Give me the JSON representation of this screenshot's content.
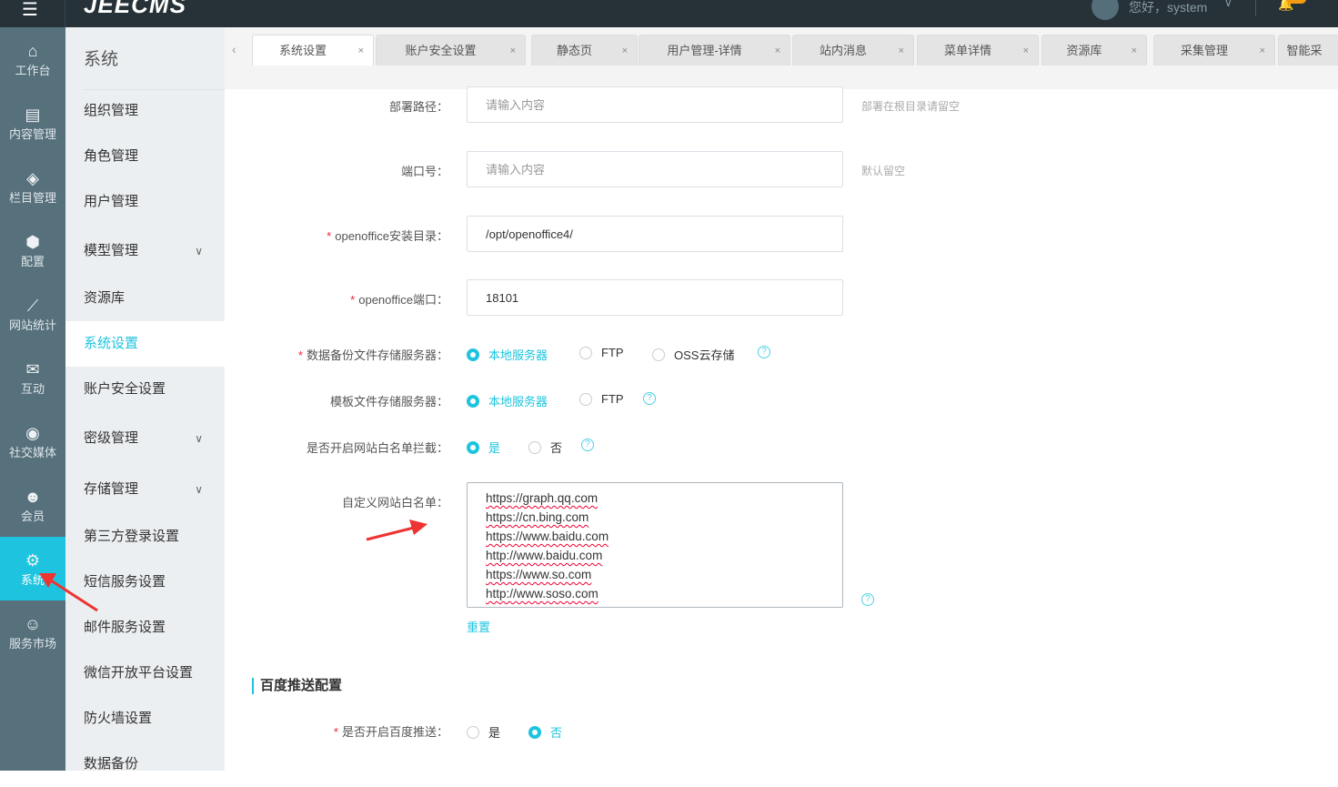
{
  "header": {
    "logo": "JEECMS",
    "greeting": "您好，system"
  },
  "iconbar": [
    {
      "label": "工作台",
      "icon": "home-icon",
      "glyph": "⌂"
    },
    {
      "label": "内容管理",
      "icon": "document-icon",
      "glyph": "▤"
    },
    {
      "label": "栏目管理",
      "icon": "layers-icon",
      "glyph": "◈"
    },
    {
      "label": "配置",
      "icon": "cube-icon",
      "glyph": "⬢"
    },
    {
      "label": "网站统计",
      "icon": "chart-icon",
      "glyph": "⟋"
    },
    {
      "label": "互动",
      "icon": "chat-icon",
      "glyph": "✉"
    },
    {
      "label": "社交媒体",
      "icon": "target-icon",
      "glyph": "◉"
    },
    {
      "label": "会员",
      "icon": "member-icon",
      "glyph": "☻"
    },
    {
      "label": "系统",
      "icon": "gear-icon",
      "glyph": "⚙"
    },
    {
      "label": "服务市场",
      "icon": "service-icon",
      "glyph": "☺"
    }
  ],
  "submenu": {
    "title": "系统",
    "items": [
      {
        "label": "组织管理"
      },
      {
        "label": "角色管理"
      },
      {
        "label": "用户管理"
      },
      {
        "label": "模型管理",
        "chev": "∨"
      },
      {
        "label": "资源库"
      },
      {
        "label": "系统设置"
      },
      {
        "label": "账户安全设置"
      },
      {
        "label": "密级管理",
        "chev": "∨"
      },
      {
        "label": "存储管理",
        "chev": "∨"
      },
      {
        "label": "第三方登录设置"
      },
      {
        "label": "短信服务设置"
      },
      {
        "label": "邮件服务设置"
      },
      {
        "label": "微信开放平台设置"
      },
      {
        "label": "防火墙设置"
      },
      {
        "label": "数据备份"
      }
    ]
  },
  "tabs": [
    "系统设置",
    "账户安全设置",
    "静态页",
    "用户管理-详情",
    "站内消息",
    "菜单详情",
    "资源库",
    "采集管理",
    "智能采"
  ],
  "form": {
    "deploy_path": {
      "label": "部署路径：",
      "placeholder": "请输入内容",
      "hint": "部署在根目录请留空"
    },
    "port": {
      "label": "端口号：",
      "placeholder": "请输入内容",
      "hint": "默认留空"
    },
    "oo_dir": {
      "label": "openoffice安装目录：",
      "value": "/opt/openoffice4/"
    },
    "oo_port": {
      "label": "openoffice端口：",
      "value": "18101"
    },
    "backup": {
      "label": "数据备份文件存储服务器：",
      "options": [
        "本地服务器",
        "FTP",
        "OSS云存储"
      ]
    },
    "template": {
      "label": "模板文件存储服务器：",
      "options": [
        "本地服务器",
        "FTP"
      ]
    },
    "whitelist_on": {
      "label": "是否开启网站白名单拦截：",
      "options": [
        "是",
        "否"
      ]
    },
    "whitelist": {
      "label": "自定义网站白名单：",
      "lines": [
        "https://graph.qq.com",
        "https://cn.bing.com",
        "https://www.baidu.com",
        "http://www.baidu.com",
        "https://www.so.com",
        "http://www.soso.com"
      ],
      "reset": "重置"
    },
    "section": "百度推送配置",
    "baidu": {
      "label": "是否开启百度推送：",
      "options": [
        "是",
        "否"
      ]
    },
    "required_mark": "*",
    "help": "?"
  },
  "colors": {
    "accent": "#1ec4df",
    "header": "#263238",
    "iconbar": "#56707c"
  }
}
